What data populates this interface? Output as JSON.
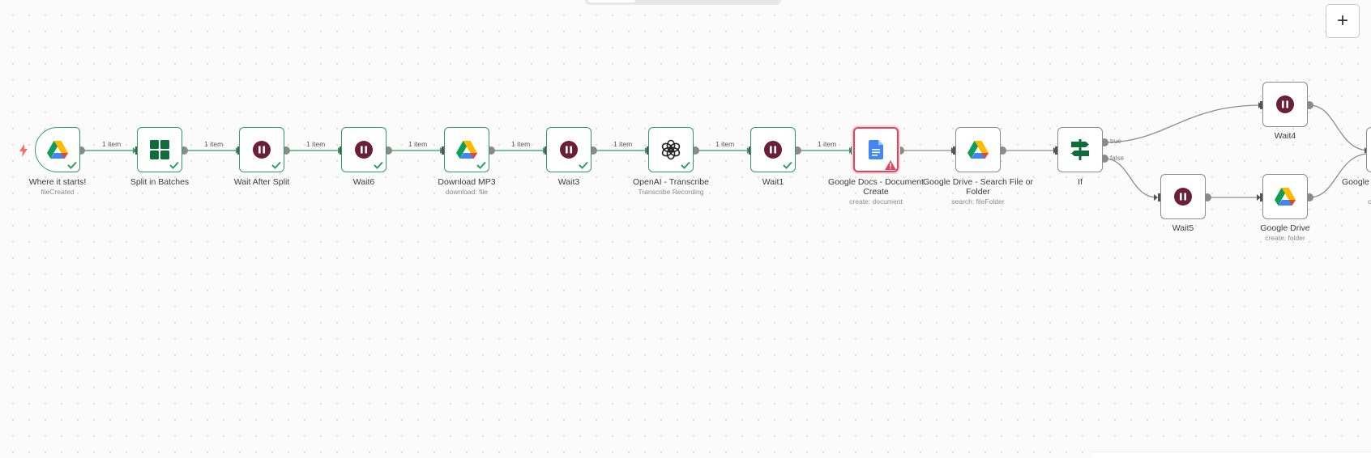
{
  "toolbar": {
    "add_node_label": "+"
  },
  "nodes": {
    "trigger": {
      "label": "Where it starts!",
      "sub": "fileCreated"
    },
    "split": {
      "label": "Split in Batches"
    },
    "wait_after": {
      "label": "Wait After Split"
    },
    "wait6": {
      "label": "Wait6"
    },
    "download": {
      "label": "Download MP3",
      "sub": "download: file"
    },
    "wait3": {
      "label": "Wait3"
    },
    "openai": {
      "label": "OpenAI - Transcribe",
      "sub": "Transcribe Recording"
    },
    "wait1": {
      "label": "Wait1"
    },
    "gdocs": {
      "label": "Google Docs - Document Create",
      "sub": "create: document"
    },
    "gdrive_search": {
      "label": "Google Drive - Search File or Folder",
      "sub": "search: fileFolder"
    },
    "if": {
      "label": "If",
      "true_label": "true",
      "false_label": "false"
    },
    "wait4": {
      "label": "Wait4"
    },
    "wait5": {
      "label": "Wait5"
    },
    "gdrive": {
      "label": "Google Drive",
      "sub": "create: folder"
    },
    "gdrive_partial": {
      "label": "Google",
      "sub": "c"
    }
  },
  "edge_label": "1 item",
  "colors": {
    "success": "#2f9e66",
    "error": "#e0455f",
    "wait": "#6b1f37",
    "idle_edge": "#8c8c8c"
  },
  "icons": {
    "drive": "google-drive-icon",
    "split": "grid-icon",
    "wait": "pause-icon",
    "openai": "openai-icon",
    "docs": "google-docs-icon",
    "if": "signpost-icon",
    "trigger": "lightning-icon"
  }
}
